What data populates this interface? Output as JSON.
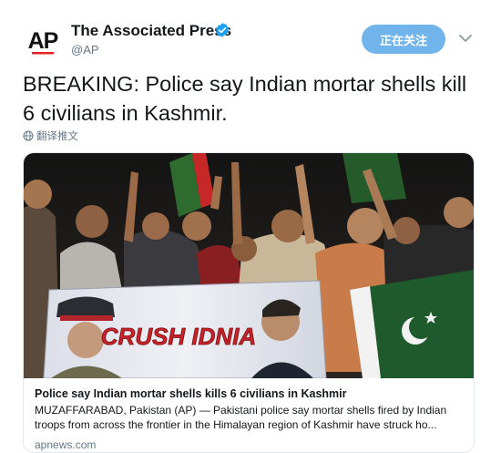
{
  "account": {
    "name": "The Associated Press",
    "handle": "@AP",
    "logo_text": "AP"
  },
  "follow_button": {
    "label": "正在关注"
  },
  "tweet": {
    "text": "BREAKING: Police say Indian mortar shells kill 6 civilians in Kashmir.",
    "translate_label": "翻译推文"
  },
  "card": {
    "title": "Police say Indian mortar shells kills 6 civilians in Kashmir",
    "description": "MUZAFFARABAD, Pakistan (AP) — Pakistani police say mortar shells fired by Indian troops from across the frontier in the Himalayan region of Kashmir have struck ho...",
    "domain": "apnews.com",
    "banner_text": "CRUSH IDNIA"
  },
  "colors": {
    "follow_button": "#71b4eb",
    "verified": "#1da1f2",
    "secondary_text": "#657786",
    "border": "#e1e8ed"
  },
  "icons": {
    "verified": "verified-badge-icon",
    "caret": "chevron-down-icon",
    "translate": "globe-icon"
  }
}
